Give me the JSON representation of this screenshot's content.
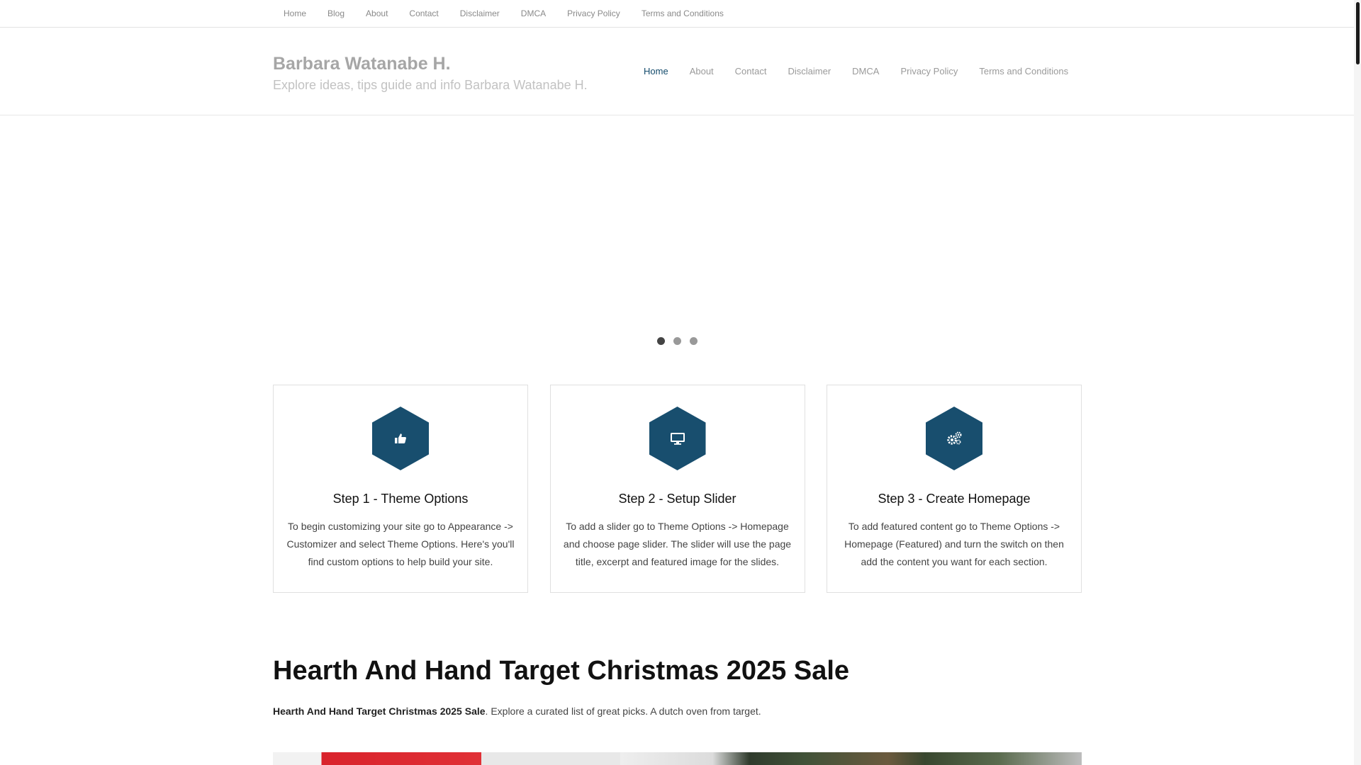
{
  "topnav": {
    "items": [
      "Home",
      "Blog",
      "About",
      "Contact",
      "Disclaimer",
      "DMCA",
      "Privacy Policy",
      "Terms and Conditions"
    ]
  },
  "header": {
    "site_title": "Barbara Watanabe H.",
    "site_description": "Explore ideas, tips guide and info Barbara Watanabe H.",
    "nav": [
      "Home",
      "About",
      "Contact",
      "Disclaimer",
      "DMCA",
      "Privacy Policy",
      "Terms and Conditions"
    ],
    "active_nav": "Home"
  },
  "slider": {
    "dots": 3,
    "active_dot": 1
  },
  "features": [
    {
      "icon": "thumbs-up-icon",
      "title": "Step 1 - Theme Options",
      "text": "To begin customizing your site go to Appearance -> Customizer and select Theme Options. Here's you'll find custom options to help build your site."
    },
    {
      "icon": "monitor-icon",
      "title": "Step 2 - Setup Slider",
      "text": "To add a slider go to Theme Options -> Homepage and choose page slider. The slider will use the page title, excerpt and featured image for the slides."
    },
    {
      "icon": "cogs-icon",
      "title": "Step 3 - Create Homepage",
      "text": "To add featured content go to Theme Options -> Homepage (Featured) and turn the switch on then add the content you want for each section."
    }
  ],
  "post": {
    "title": "Hearth And Hand Target Christmas 2025 Sale",
    "intro_bold": "Hearth And Hand Target Christmas 2025 Sale",
    "intro_rest": ". Explore a curated list of great picks. A dutch oven from target."
  },
  "colors": {
    "accent": "#184e6e",
    "active_nav": "#124a6b",
    "dot_active": "#444444",
    "dot_inactive": "#999999"
  }
}
